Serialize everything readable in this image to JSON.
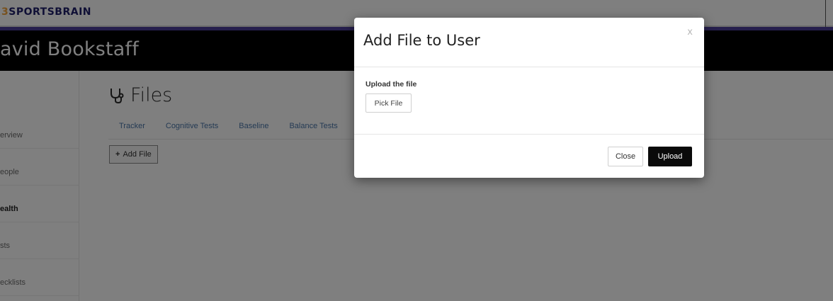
{
  "app": {
    "logo_prefix": "3",
    "logo_text": "SPORTSBRAIN"
  },
  "user": {
    "name": "avid Bookstaff"
  },
  "sidebar": {
    "items": [
      {
        "label": "erview",
        "active": false
      },
      {
        "label": "eople",
        "active": false
      },
      {
        "label": "ealth",
        "active": true
      },
      {
        "label": "sts",
        "active": false
      },
      {
        "label": "ecklists",
        "active": false
      }
    ]
  },
  "page": {
    "icon": "stethoscope-icon",
    "title": "Files",
    "tabs": [
      "Tracker",
      "Cognitive Tests",
      "Baseline",
      "Balance Tests"
    ],
    "add_file_label": "Add File",
    "add_file_icon": "plus-icon"
  },
  "modal": {
    "title": "Add File to User",
    "close_glyph": "x",
    "upload_label": "Upload the file",
    "pick_file_label": "Pick File",
    "close_label": "Close",
    "upload_button_label": "Upload"
  },
  "colors": {
    "brand_purple": "#4c3f9a",
    "brand_orange": "#f0a23c",
    "link_blue": "#4a76a8",
    "primary_button": "#0a0a0a"
  }
}
